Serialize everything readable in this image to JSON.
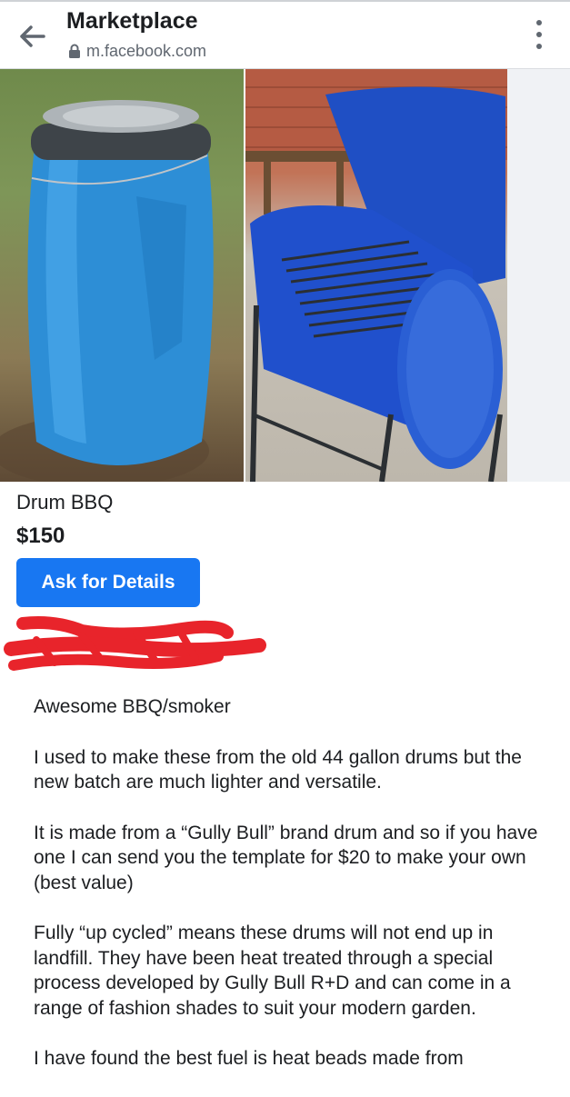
{
  "header": {
    "title": "Marketplace",
    "url": "m.facebook.com",
    "back_icon": "arrow-left-icon",
    "lock_icon": "lock-icon",
    "menu_icon": "more-vertical-icon"
  },
  "listing": {
    "title": "Drum BBQ",
    "price": "$150",
    "ask_button": "Ask for Details",
    "accent_color": "#1877f2",
    "description": [
      "Awesome BBQ/smoker",
      "I used to make these from the old 44 gallon drums but the new batch are much lighter and versatile.",
      "It is made from a “Gully Bull” brand drum and so if you have one I can send you the template for $20 to make your own (best value)",
      "Fully “up cycled” means these drums will not end up in landfill. They have been heat treated through a special process developed by Gully Bull R+D and can come in a range of fashion shades to suit your modern garden.",
      "I have found the best fuel is heat beads made from"
    ]
  }
}
